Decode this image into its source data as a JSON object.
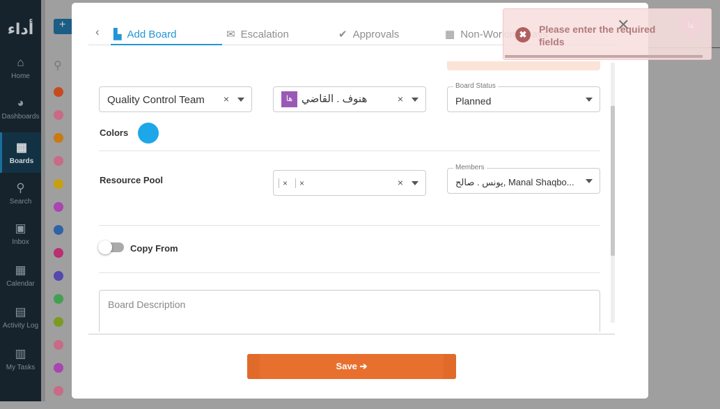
{
  "sidebar": {
    "logo": "أداء",
    "items": [
      {
        "label": "Home",
        "icon": "⌂"
      },
      {
        "label": "Dashboards",
        "icon": "◕"
      },
      {
        "label": "Boards",
        "icon": "▦"
      },
      {
        "label": "Search",
        "icon": "⚲"
      },
      {
        "label": "Inbox",
        "icon": "▣"
      },
      {
        "label": "Calendar",
        "icon": "▦"
      },
      {
        "label": "Activity Log",
        "icon": "▤"
      },
      {
        "label": "My Tasks",
        "icon": "▥"
      }
    ]
  },
  "background": {
    "add": "+",
    "dot_colors": [
      "#c64a1e",
      "#c96a86",
      "#c97a10",
      "#c96a86",
      "#c7a010",
      "#a845b0",
      "#2f62a8",
      "#b83070",
      "#5248b0",
      "#42a050",
      "#7c9a20",
      "#c96a86",
      "#a845b0",
      "#c96a86"
    ]
  },
  "tabs": [
    {
      "label": "Add Board",
      "icon": "▙"
    },
    {
      "label": "Escalation",
      "icon": "✉"
    },
    {
      "label": "Approvals",
      "icon": "✔"
    },
    {
      "label": "Non-Working Days",
      "icon": "▦"
    }
  ],
  "form": {
    "team": "Quality Control Team",
    "owner": {
      "initials": "ها",
      "name": "هنوف . القاضي"
    },
    "board_status": {
      "label": "Board Status",
      "value": "Planned"
    },
    "colors_label": "Colors",
    "color": "#1ea7e8",
    "resource_pool_label": "Resource Pool",
    "members": {
      "label": "Members",
      "value": "يونس . صالح, Manal Shaqbo..."
    },
    "copy_from": "Copy From",
    "copy_from_on": false,
    "description_placeholder": "Board Description",
    "save": "Save"
  },
  "toast": {
    "message": "Please enter the required fields"
  },
  "user": {
    "initials": "ها"
  }
}
